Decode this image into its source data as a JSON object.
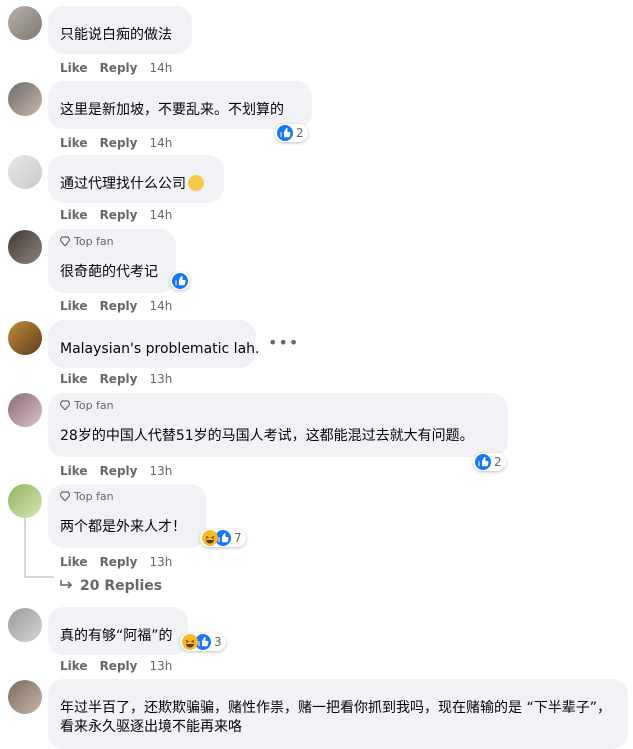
{
  "actions": {
    "like": "Like",
    "reply": "Reply"
  },
  "comments": [
    {
      "name": "",
      "text": "只能说白痴的做法",
      "time": "14h"
    },
    {
      "name": "",
      "text": "这里是新加坡，不要乱来。不划算的",
      "time": "14h",
      "reaction_count": "2"
    },
    {
      "name": "",
      "text": "通过代理找什么公司",
      "time": "14h"
    },
    {
      "badge": "Top fan",
      "name": "",
      "text": "很奇葩的代考记",
      "time": "14h"
    },
    {
      "name": "",
      "text": "Malaysian's problematic lah.",
      "time": "13h"
    },
    {
      "badge": "Top fan",
      "name": "",
      "text": "28岁的中国人代替51岁的马国人考试，这都能混过去就大有问题。",
      "time": "13h",
      "reaction_count": "2"
    },
    {
      "badge": "Top fan",
      "name": "",
      "text": "两个都是外来人才！",
      "time": "13h",
      "reaction_count": "7",
      "replies": "20 Replies"
    },
    {
      "name": "",
      "text": "真的有够“阿福”的",
      "time": "13h",
      "reaction_count": "3"
    },
    {
      "name": "",
      "text": "年过半百了，还欺欺骗骗，赌性作祟，赌一把看你抓到我吗，现在赌输的是 “下半辈子”，看来永久驱逐出境不能再来咯"
    }
  ],
  "colors": {
    "like_blue": "#1877f2",
    "bubble": "#f0f2f5",
    "meta_gray": "#65676b"
  },
  "icons": {
    "like": "thumbs-up-icon",
    "haha": "haha-emoji-icon",
    "thinking": "thinking-emoji-icon",
    "more": "more-horizontal-icon",
    "reply_arrow": "reply-arrow-icon",
    "top_fan": "top-fan-gem-icon"
  }
}
